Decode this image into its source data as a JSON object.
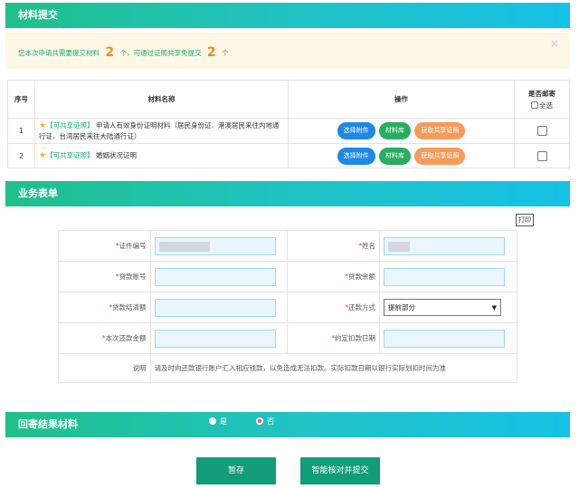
{
  "materials": {
    "title": "材料提交",
    "notice": {
      "prefix": "您本次申请共需要提交材料",
      "count1": "2",
      "mid": "个，可通过证照共享免提交",
      "count2": "2",
      "suffix": "个",
      "close": "×"
    },
    "headers": {
      "index": "序号",
      "name": "材料名称",
      "action": "操作",
      "mail": "是否邮寄",
      "select_all": "全选"
    },
    "rows": [
      {
        "index": "1",
        "tag": "【可共享证照】",
        "name": "申请人有效身份证明材料（居民身份证、港澳居民来往内地通行证、台湾居民来往大陆通行证）"
      },
      {
        "index": "2",
        "tag": "【可共享证照】",
        "name": "婚姻状况证明"
      }
    ],
    "actions": {
      "attach": "选择附件",
      "library": "材料库",
      "share": "获取共享证照"
    },
    "icons": {
      "star": "star-icon"
    }
  },
  "business_form": {
    "title": "业务表单",
    "print": "打印",
    "required_mark": "*",
    "fields": {
      "id_no": "证件编号",
      "name": "姓名",
      "loan_account": "贷款账号",
      "loan_balance": "贷款余额",
      "settle_amount": "贷款结清额",
      "repay_method": "还款方式",
      "repay_method_value": "提前部分",
      "this_repay_amount": "本次还款金额",
      "agreed_date": "约定扣款日期"
    },
    "note_label": "说明",
    "note_text": "请及时向还款银行账户汇入相应钱款，以免造成无法扣款。实际扣款日期以银行实际划扣时间为准"
  },
  "return_materials": {
    "title": "回寄结果材料",
    "options": [
      "是",
      "否"
    ],
    "selected": "否"
  },
  "buttons": {
    "save": "暂存",
    "submit": "智能核对并提交"
  },
  "colors": {
    "bar_start": "#20c08a",
    "bar_end": "#16c2e6",
    "accent_green": "#19a67a",
    "count_orange": "#f08a24",
    "btn_blue": "#1e88e5",
    "btn_green": "#27ae60",
    "btn_orange": "#f39c5c",
    "action_btn": "#129c78",
    "required_red": "#e53935"
  }
}
